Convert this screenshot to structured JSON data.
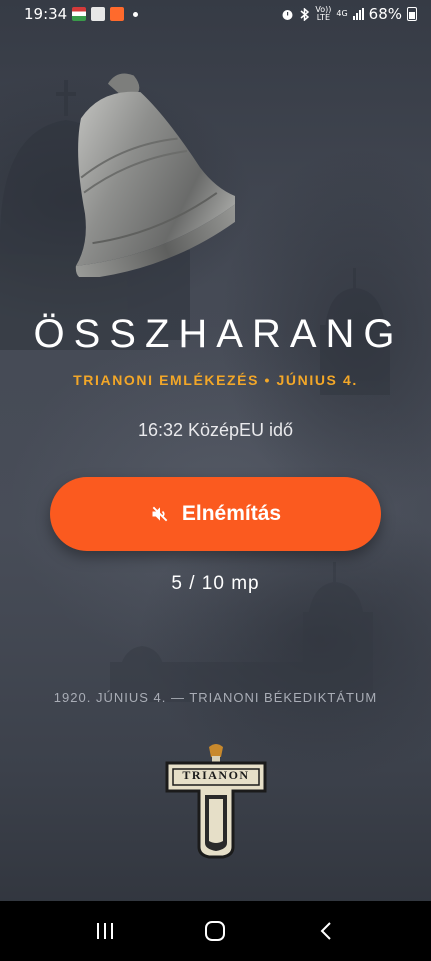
{
  "status_bar": {
    "time": "19:34",
    "battery": "68%",
    "network_top": "Vo))",
    "network_bottom": "LTE",
    "gen": "4G"
  },
  "app": {
    "title": "ÖSSZHARANG",
    "subtitle": "TRIANONI EMLÉKEZÉS • JÚNIUS 4.",
    "time_label": "16:32 KözépEU idő",
    "mute_button_label": "Elnémítás",
    "counter": "5 / 10 mp",
    "footnote": "1920. JÚNIUS 4. — TRIANONI BÉKEDIKTÁTUM",
    "logo_text": "TRIANON"
  },
  "colors": {
    "accent": "#fb5a1f",
    "subtitle": "#f3a728",
    "background": "#3c414c"
  },
  "icons": {
    "mute": "volume-off-icon",
    "recents": "recents-icon",
    "home": "home-icon",
    "back": "back-icon"
  }
}
